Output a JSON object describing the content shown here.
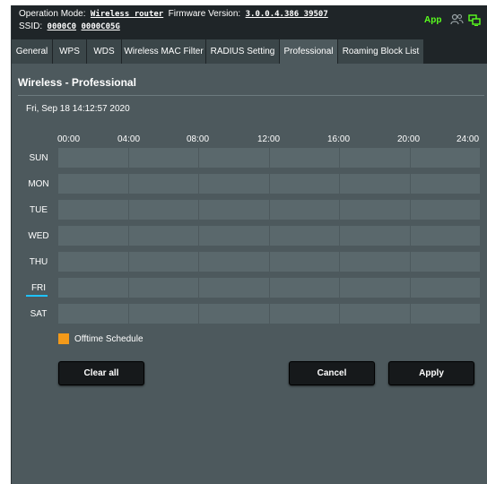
{
  "header": {
    "operation_mode_label": "Operation Mode:",
    "operation_mode_value": "Wireless router",
    "firmware_label": "Firmware Version:",
    "firmware_value": "3.0.0.4.386_39507",
    "ssid_label": "SSID:",
    "ssid_1": "0000C0",
    "ssid_2": "0000C05G",
    "app_label": "App",
    "icons": [
      "people-icon",
      "monitor-icon"
    ],
    "accent_color": "#5aff1e"
  },
  "tabs": [
    {
      "label": "General"
    },
    {
      "label": "WPS"
    },
    {
      "label": "WDS"
    },
    {
      "label": "Wireless MAC Filter"
    },
    {
      "label": "RADIUS Setting"
    },
    {
      "label": "Professional",
      "active": true
    },
    {
      "label": "Roaming Block List"
    }
  ],
  "section": {
    "title": "Wireless - Professional",
    "date": "Fri, Sep 18 14:12:57 2020"
  },
  "schedule": {
    "hours": [
      "00:00",
      "04:00",
      "08:00",
      "12:00",
      "16:00",
      "20:00",
      "24:00"
    ],
    "days": [
      "SUN",
      "MON",
      "TUE",
      "WED",
      "THU",
      "FRI",
      "SAT"
    ],
    "current_day": "FRI",
    "legend": "Offtime Schedule",
    "legend_color": "#f39a1a"
  },
  "buttons": {
    "clear_all": "Clear all",
    "cancel": "Cancel",
    "apply": "Apply"
  }
}
